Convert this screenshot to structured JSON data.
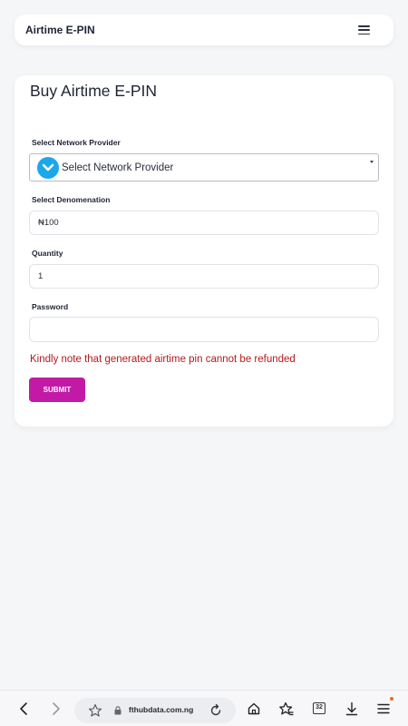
{
  "header": {
    "title": "Airtime E-PIN",
    "menu_icon": "hamburger-menu-icon"
  },
  "form": {
    "title": "Buy Airtime E-PIN",
    "network": {
      "label": "Select Network Provider",
      "selected": "Select Network Provider"
    },
    "denomination": {
      "label": "Select Denomenation",
      "value": "₦100"
    },
    "quantity": {
      "label": "Quantity",
      "value": "1"
    },
    "password": {
      "label": "Password",
      "value": ""
    },
    "notice": "Kindly note that generated airtime pin cannot be refunded",
    "submit_label": "SUBMIT"
  },
  "browser": {
    "url": "fthubdata.com.ng",
    "tab_count": "32"
  },
  "colors": {
    "accent": "#c21aa6",
    "notice": "#b3191e",
    "select_icon": "#1aa7ec"
  }
}
